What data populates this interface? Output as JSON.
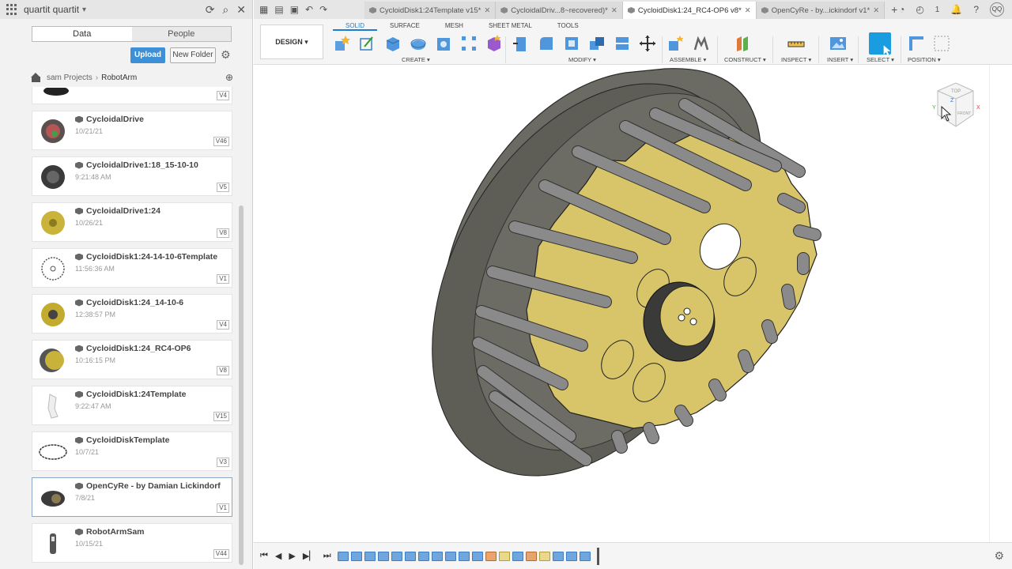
{
  "left_panel": {
    "user": "quartit quartit",
    "tabs": [
      "Data",
      "People"
    ],
    "upload_label": "Upload",
    "new_folder_label": "New Folder",
    "breadcrumb": [
      "sam Projects",
      "RobotArm"
    ],
    "top_partial_version": "V4",
    "items": [
      {
        "name": "CycloidalDrive",
        "date": "10/21/21",
        "version": "V46"
      },
      {
        "name": "CycloidalDrive1:18_15-10-10",
        "date": "9:21:48 AM",
        "version": "V5"
      },
      {
        "name": "CycloidalDrive1:24",
        "date": "10/26/21",
        "version": "V8"
      },
      {
        "name": "CycloidDisk1:24-14-10-6Template",
        "date": "11:56:36 AM",
        "version": "V1"
      },
      {
        "name": "CycloidDisk1:24_14-10-6",
        "date": "12:38:57 PM",
        "version": "V4"
      },
      {
        "name": "CycloidDisk1:24_RC4-OP6",
        "date": "10:16:15 PM",
        "version": "V8"
      },
      {
        "name": "CycloidDisk1:24Template",
        "date": "9:22:47 AM",
        "version": "V15"
      },
      {
        "name": "CycloidDiskTemplate",
        "date": "10/7/21",
        "version": "V3"
      },
      {
        "name": "OpenCyRe - by Damian Lickindorf",
        "date": "7/8/21",
        "version": "V1"
      },
      {
        "name": "RobotArmSam",
        "date": "10/15/21",
        "version": "V44"
      }
    ]
  },
  "tabs": [
    {
      "label": "CycloidDisk1:24Template v15*"
    },
    {
      "label": "CycloidalDriv...8~recovered)*"
    },
    {
      "label": "CycloidDisk1:24_RC4-OP6 v8*"
    },
    {
      "label": "OpenCyRe - by...ickindorf v1*"
    }
  ],
  "header": {
    "notif_count": "1",
    "avatar": "QQ"
  },
  "ribbon": {
    "workspace": "DESIGN ▾",
    "workspace_tabs": [
      "SOLID",
      "SURFACE",
      "MESH",
      "SHEET METAL",
      "TOOLS"
    ],
    "groups": [
      "CREATE ▾",
      "MODIFY ▾",
      "ASSEMBLE ▾",
      "CONSTRUCT ▾",
      "INSPECT ▾",
      "INSERT ▾",
      "SELECT ▾",
      "POSITION ▾"
    ]
  },
  "navcube": {
    "face_top": "TOP",
    "face_front": "FRONT",
    "axis_x": "X",
    "axis_y": "Y",
    "axis_z": "Z"
  },
  "colors": {
    "accent": "#1a7fd1",
    "disk": "#d8c56a",
    "pin": "#7a7a7a",
    "housing": "#6b6b63"
  }
}
